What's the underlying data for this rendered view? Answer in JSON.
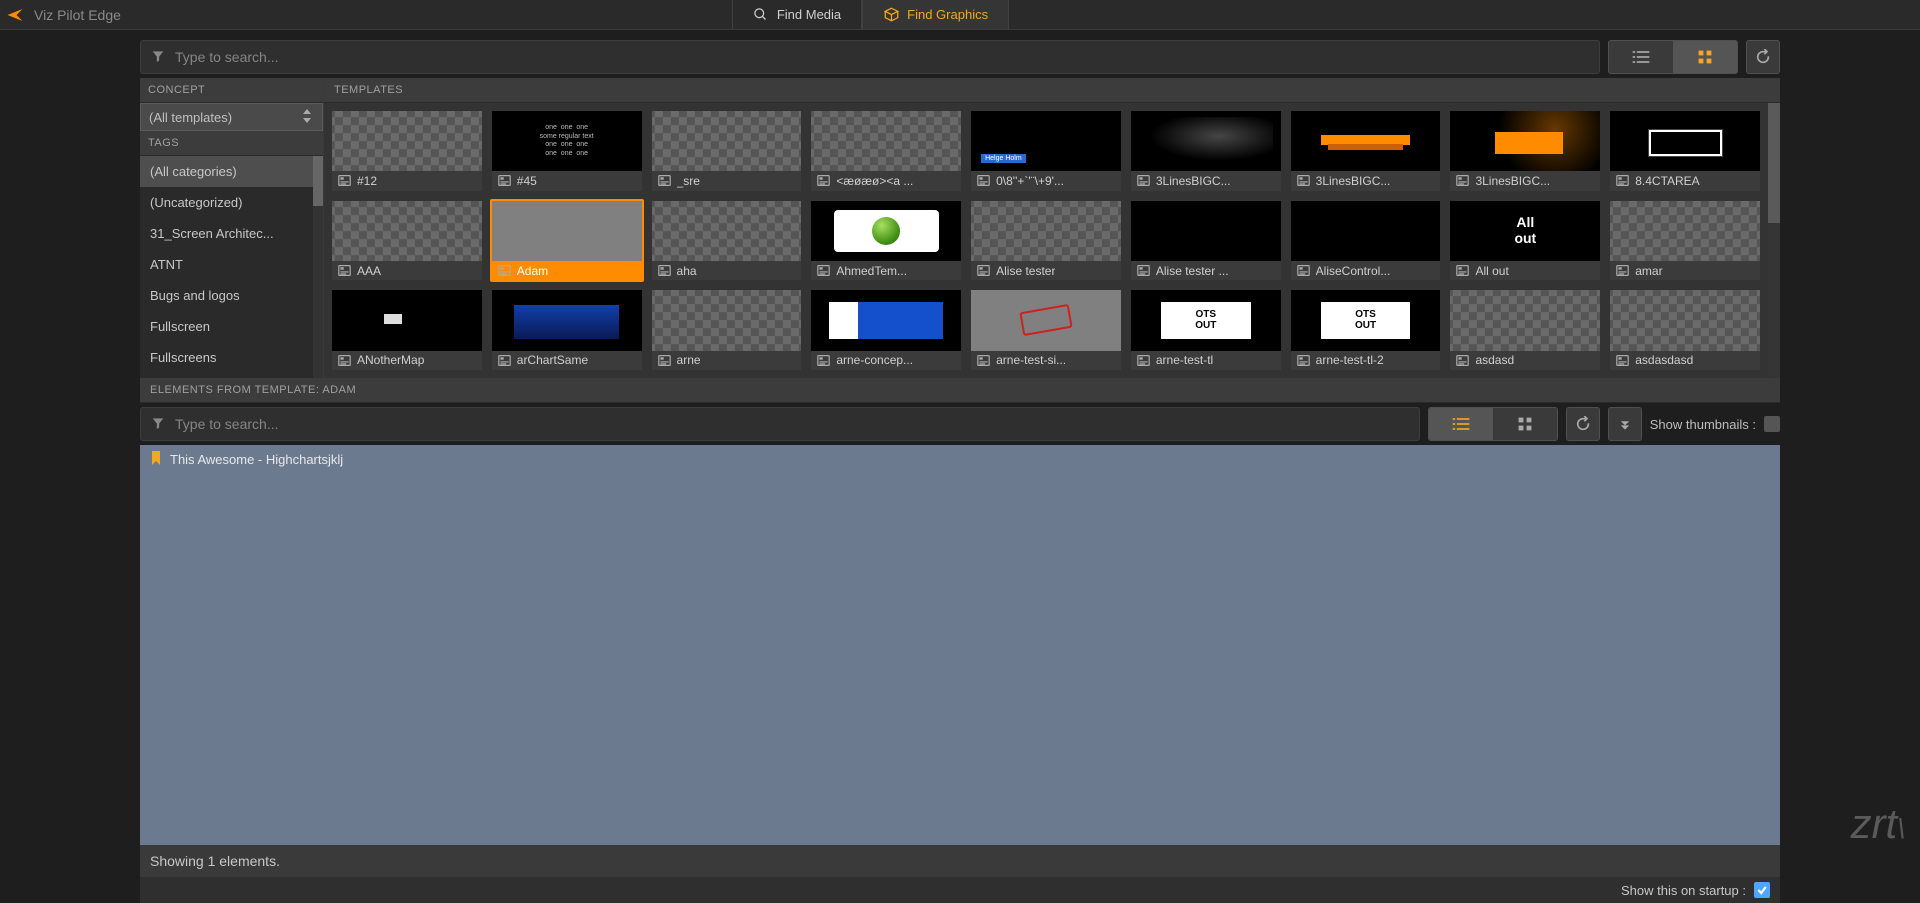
{
  "app_title": "Viz Pilot Edge",
  "tabs": {
    "find_media": "Find Media",
    "find_graphics": "Find Graphics"
  },
  "top_search": {
    "placeholder": "Type to search..."
  },
  "sidebar": {
    "concept_label": "Concept",
    "concept_selected": "(All templates)",
    "tags_label": "Tags",
    "tags": [
      "(All categories)",
      "(Uncategorized)",
      "31_Screen Architec...",
      "ATNT",
      "Bugs and logos",
      "Fullscreen",
      "Fullscreens"
    ]
  },
  "templates_label": "Templates",
  "templates": [
    {
      "name": "#12",
      "thumb": "checker"
    },
    {
      "name": "#45",
      "thumb": "black",
      "deco": "text"
    },
    {
      "name": "_sre",
      "thumb": "checker"
    },
    {
      "name": "<æøæø><a ...",
      "thumb": "checker"
    },
    {
      "name": "0\\8''+`'¨\\+9'...",
      "thumb": "black",
      "deco": "helge"
    },
    {
      "name": "3LinesBIGC...",
      "thumb": "black",
      "deco": "smoke"
    },
    {
      "name": "3LinesBIGC...",
      "thumb": "black",
      "deco": "orange1"
    },
    {
      "name": "3LinesBIGC...",
      "thumb": "black",
      "deco": "orange2"
    },
    {
      "name": "8.4CTAREA",
      "thumb": "black",
      "deco": "white-rect"
    },
    {
      "name": "AAA",
      "thumb": "checker"
    },
    {
      "name": "Adam",
      "thumb": "gray",
      "selected": true
    },
    {
      "name": "aha",
      "thumb": "checker"
    },
    {
      "name": "AhmedTem...",
      "thumb": "black",
      "deco": "sphere"
    },
    {
      "name": "Alise tester",
      "thumb": "checker"
    },
    {
      "name": "Alise tester ...",
      "thumb": "black"
    },
    {
      "name": "AliseControl...",
      "thumb": "black"
    },
    {
      "name": "All out",
      "thumb": "black",
      "deco": "allout"
    },
    {
      "name": "amar",
      "thumb": "checker"
    },
    {
      "name": "ANotherMap",
      "thumb": "black",
      "deco": "map"
    },
    {
      "name": "arChartSame",
      "thumb": "black",
      "deco": "chart"
    },
    {
      "name": "arne",
      "thumb": "checker"
    },
    {
      "name": "arne-concep...",
      "thumb": "black",
      "deco": "concept"
    },
    {
      "name": "arne-test-si...",
      "thumb": "gray",
      "deco": "stamp"
    },
    {
      "name": "arne-test-tl",
      "thumb": "black",
      "deco": "otsout"
    },
    {
      "name": "arne-test-tl-2",
      "thumb": "black",
      "deco": "otsout"
    },
    {
      "name": "asdasd",
      "thumb": "checker"
    },
    {
      "name": "asdasdasd",
      "thumb": "checker"
    }
  ],
  "elements_header": "Elements from template: Adam",
  "elements_search": {
    "placeholder": "Type to search..."
  },
  "show_thumbnails_label": "Show thumbnails :",
  "elements": [
    {
      "title": "This Awesome - Highchartsjklj"
    }
  ],
  "status_text": "Showing 1 elements.",
  "startup_label": "Show this on startup :",
  "watermark": "zrt"
}
